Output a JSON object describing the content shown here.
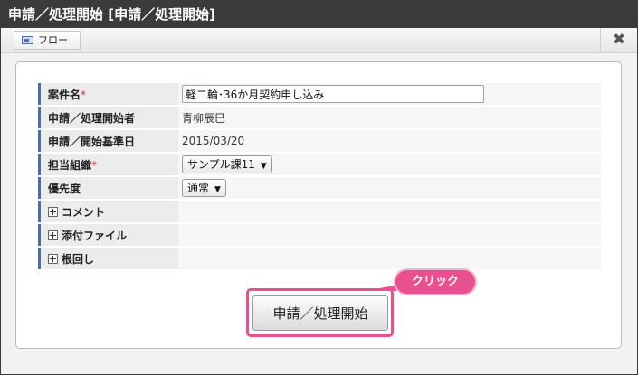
{
  "window": {
    "title": "申請／処理開始 [申請／処理開始]"
  },
  "toolbar": {
    "flow_tab_label": "フロー",
    "close_icon": "close-icon"
  },
  "form": {
    "fields": [
      {
        "label": "案件名",
        "required": true,
        "type": "text",
        "value": "軽二輪･36か月契約申し込み"
      },
      {
        "label": "申請／処理開始者",
        "required": false,
        "type": "static",
        "value": "青柳辰巳"
      },
      {
        "label": "申請／開始基準日",
        "required": false,
        "type": "static",
        "value": "2015/03/20"
      },
      {
        "label": "担当組織",
        "required": true,
        "type": "select",
        "value": "サンプル課11"
      },
      {
        "label": "優先度",
        "required": false,
        "type": "select",
        "value": "通常"
      }
    ],
    "expandables": [
      {
        "label": "コメント"
      },
      {
        "label": "添付ファイル"
      },
      {
        "label": "根回し"
      }
    ],
    "required_mark": "*"
  },
  "actions": {
    "submit_label": "申請／処理開始"
  },
  "annotation": {
    "callout_text": "クリック",
    "highlight_color": "#e8508f"
  }
}
